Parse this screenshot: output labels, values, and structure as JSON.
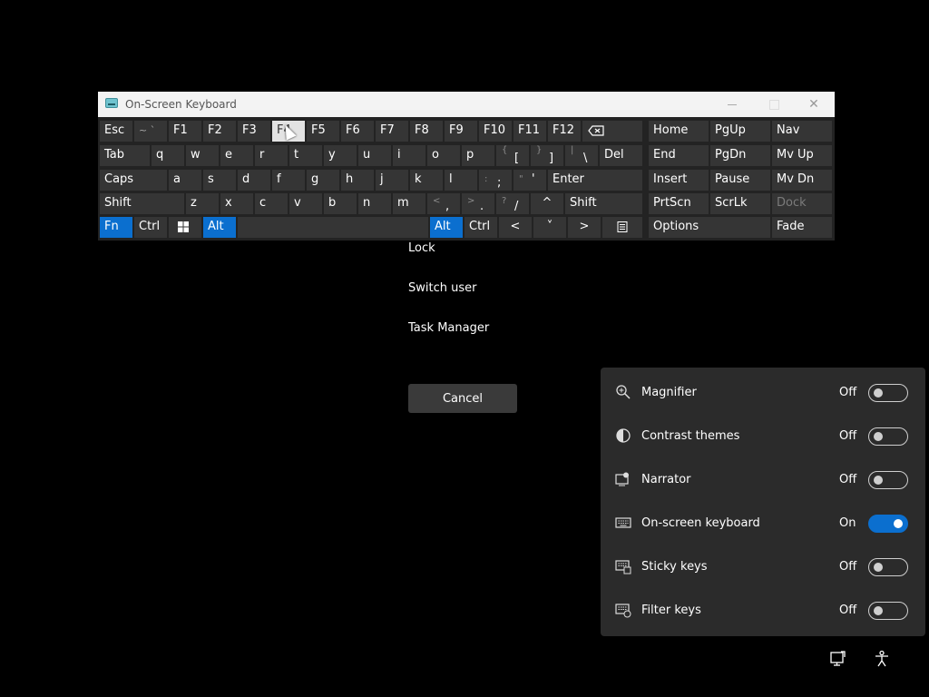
{
  "osk": {
    "title": "On-Screen Keyboard",
    "close_glyph": "✕",
    "rows": {
      "r1": [
        "Esc",
        "~ `",
        "F1",
        "F2",
        "F3",
        "F4",
        "F5",
        "F6",
        "F7",
        "F8",
        "F9",
        "F10",
        "F11",
        "F12"
      ],
      "r1_right": [
        "Home",
        "PgUp",
        "Nav"
      ],
      "r2": [
        "Tab",
        "q",
        "w",
        "e",
        "r",
        "t",
        "y",
        "u",
        "i",
        "o",
        "p"
      ],
      "r2_brace_top": "{",
      "r2_brace_main": "[",
      "r2_rbrace_top": "}",
      "r2_rbrace_main": "]",
      "r2_pipe_top": "|",
      "r2_pipe_main": "\\",
      "r2_del": "Del",
      "r2_right": [
        "End",
        "PgDn",
        "Mv Up"
      ],
      "r3": [
        "Caps",
        "a",
        "s",
        "d",
        "f",
        "g",
        "h",
        "j",
        "k",
        "l"
      ],
      "r3_colon_top": ":",
      "r3_colon_main": ";",
      "r3_quote_top": "\"",
      "r3_quote_main": "'",
      "r3_enter": "Enter",
      "r3_right": [
        "Insert",
        "Pause",
        "Mv Dn"
      ],
      "r4": [
        "Shift",
        "z",
        "x",
        "c",
        "v",
        "b",
        "n",
        "m"
      ],
      "r4_lt_top": "<",
      "r4_lt_main": ",",
      "r4_gt_top": ">",
      "r4_gt_main": ".",
      "r4_q_top": "?",
      "r4_q_main": "/",
      "r4_up": "^",
      "r4_shift_r": "Shift",
      "r4_right": [
        "PrtScn",
        "ScrLk",
        "Dock"
      ],
      "r5": [
        "Fn",
        "Ctrl",
        "Alt",
        "Alt",
        "Ctrl"
      ],
      "r5_left": "<",
      "r5_down": "˅",
      "r5_right_arrow": ">",
      "options": "Options",
      "fade": "Fade"
    }
  },
  "cad": {
    "items": [
      "Lock",
      "Switch user",
      "Task Manager"
    ],
    "cancel": "Cancel"
  },
  "a11y": {
    "rows": [
      {
        "label": "Magnifier",
        "state": "Off",
        "icon": "magnifier-icon"
      },
      {
        "label": "Contrast themes",
        "state": "Off",
        "icon": "contrast-icon"
      },
      {
        "label": "Narrator",
        "state": "Off",
        "icon": "narrator-icon"
      },
      {
        "label": "On-screen keyboard",
        "state": "On",
        "icon": "keyboard-icon"
      },
      {
        "label": "Sticky keys",
        "state": "Off",
        "icon": "sticky-keys-icon"
      },
      {
        "label": "Filter keys",
        "state": "Off",
        "icon": "filter-keys-icon"
      }
    ]
  },
  "colors": {
    "accent": "#0b6fcf",
    "panel": "#2b2b2b",
    "key": "#353535"
  }
}
